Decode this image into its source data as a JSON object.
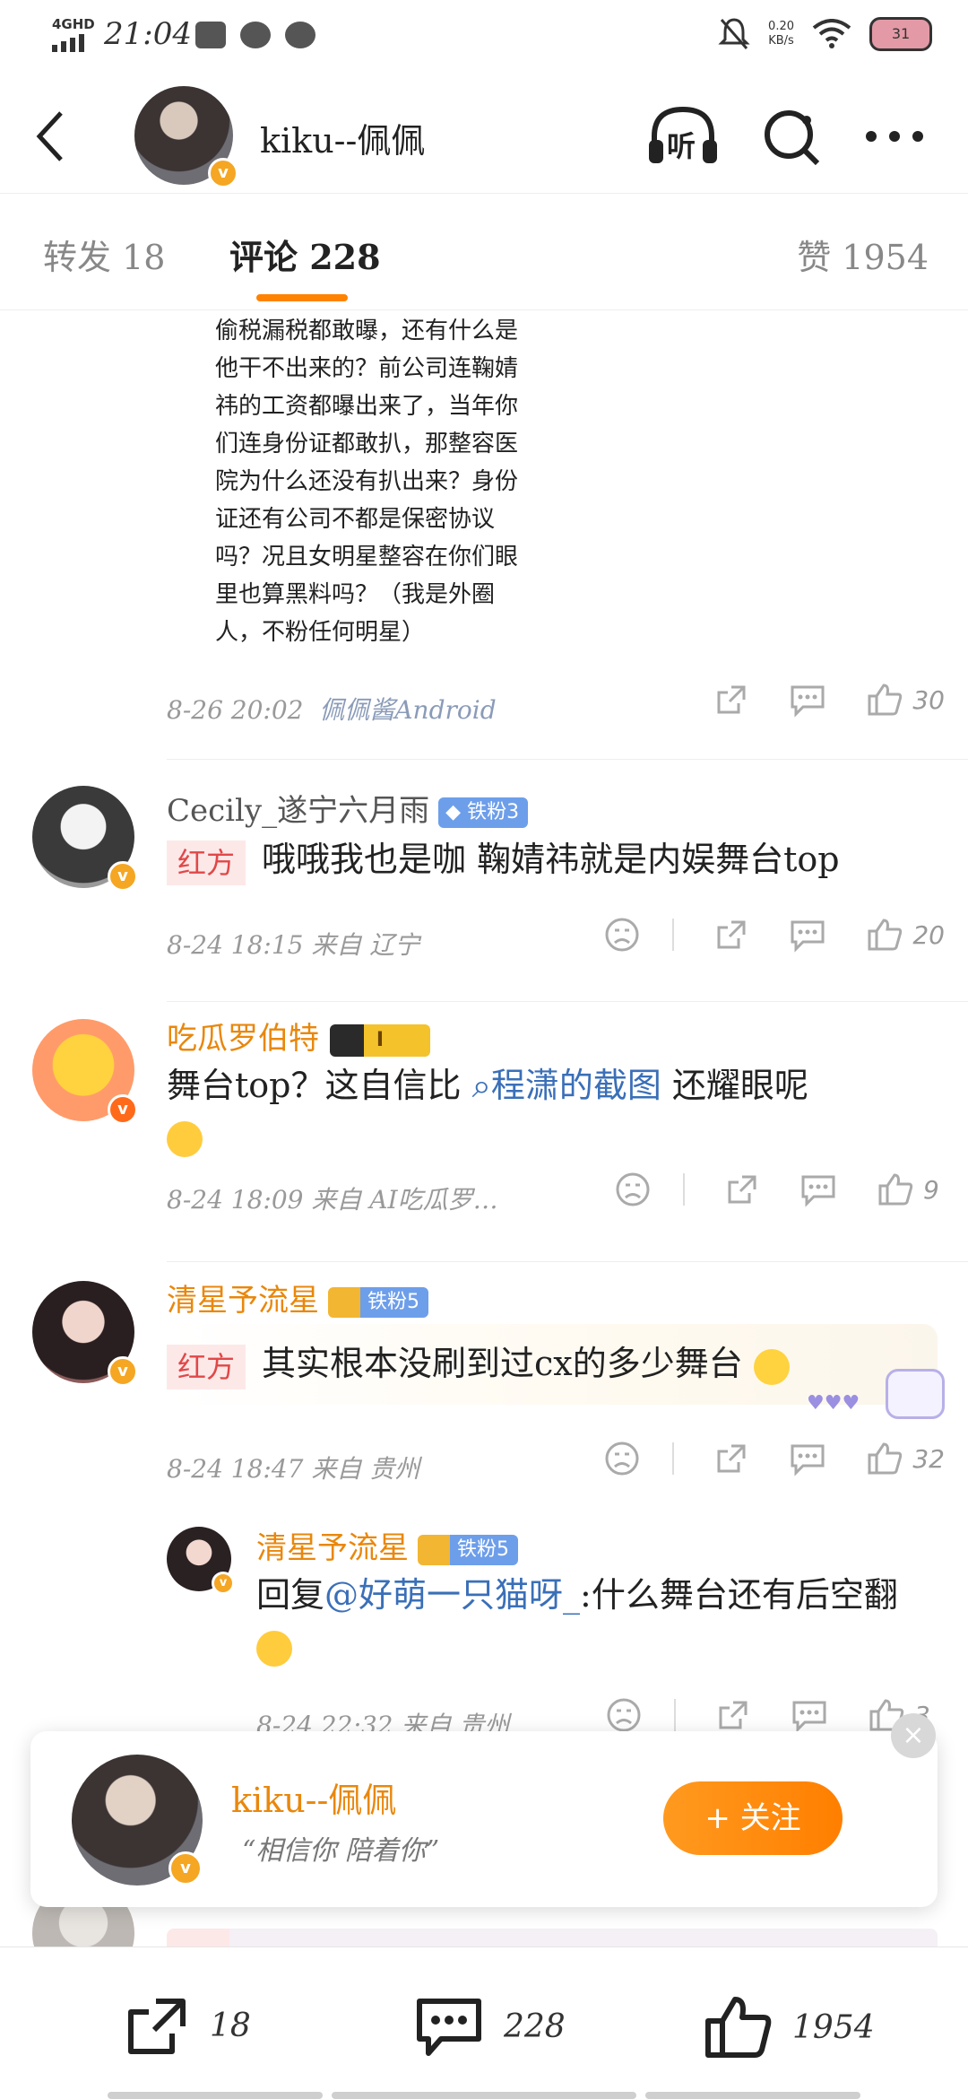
{
  "status_bar": {
    "network": "4GHD",
    "time": "21:04",
    "speed_value": "0.20",
    "speed_unit": "KB/s",
    "battery": "31",
    "icons": [
      "signal-icon",
      "vivo-icon",
      "wechat-icon",
      "weibo-icon",
      "mute-icon",
      "wifi-icon",
      "battery-icon"
    ]
  },
  "header": {
    "title": "kiku--佩佩",
    "listen_label": "听",
    "icons": [
      "back-icon",
      "listen-icon",
      "search-icon",
      "more-icon"
    ]
  },
  "tabs": {
    "repost": "转发 18",
    "comments": "评论 228",
    "likes": "赞 1954"
  },
  "top_comment": {
    "text": "偷税漏税都敢曝，还有什么是他干不出来的？前公司连鞠婧祎的工资都曝出来了，当年你们连身份证都敢扒，那整容医院为什么还没有扒出来？身份证还有公司不都是保密协议吗？况且女明星整容在你们眼里也算黑料吗？（我是外圈人，不粉任何明星）",
    "meta": "8-26 20:02",
    "source": "佩佩酱Android",
    "likes": "30"
  },
  "comments": [
    {
      "name": "Cecily_遂宁六月雨",
      "badge": "铁粉3",
      "tag": "红方",
      "text": "哦哦我也是咖 鞠婧祎就是内娱舞台top",
      "meta": "8-24 18:15  来自 辽宁",
      "likes": "20"
    },
    {
      "name": "吃瓜罗伯特",
      "badge": "I",
      "text_before": "舞台top？这自信比",
      "link": "程潇的截图",
      "text_after": "还耀眼呢",
      "meta": "8-24 18:09  来自 AI吃瓜罗…",
      "likes": "9"
    },
    {
      "name": "清星予流星",
      "badge": "铁粉5",
      "tag": "红方",
      "text": "其实根本没刷到过cx的多少舞台",
      "meta": "8-24 18:47  来自 贵州",
      "likes": "32"
    }
  ],
  "reply": {
    "name": "清星予流星",
    "badge": "铁粉5",
    "prefix": "回复",
    "mention": "@好萌一只猫呀_",
    "text": ":什么舞台还有后空翻",
    "meta": "8-24 22:32  来自 贵州",
    "likes": "3"
  },
  "follow_card": {
    "name": "kiku--佩佩",
    "quote": "“相信你  陪着你”",
    "button": "+ 关注",
    "close": "×"
  },
  "bottom_bar": {
    "reposts": "18",
    "comments": "228",
    "likes": "1954"
  },
  "colors": {
    "accent": "#ff8200",
    "username": "#e9870c",
    "link": "#3a6fb8",
    "red_tag": "#e04848",
    "fan_badge": "#6d9eea"
  }
}
